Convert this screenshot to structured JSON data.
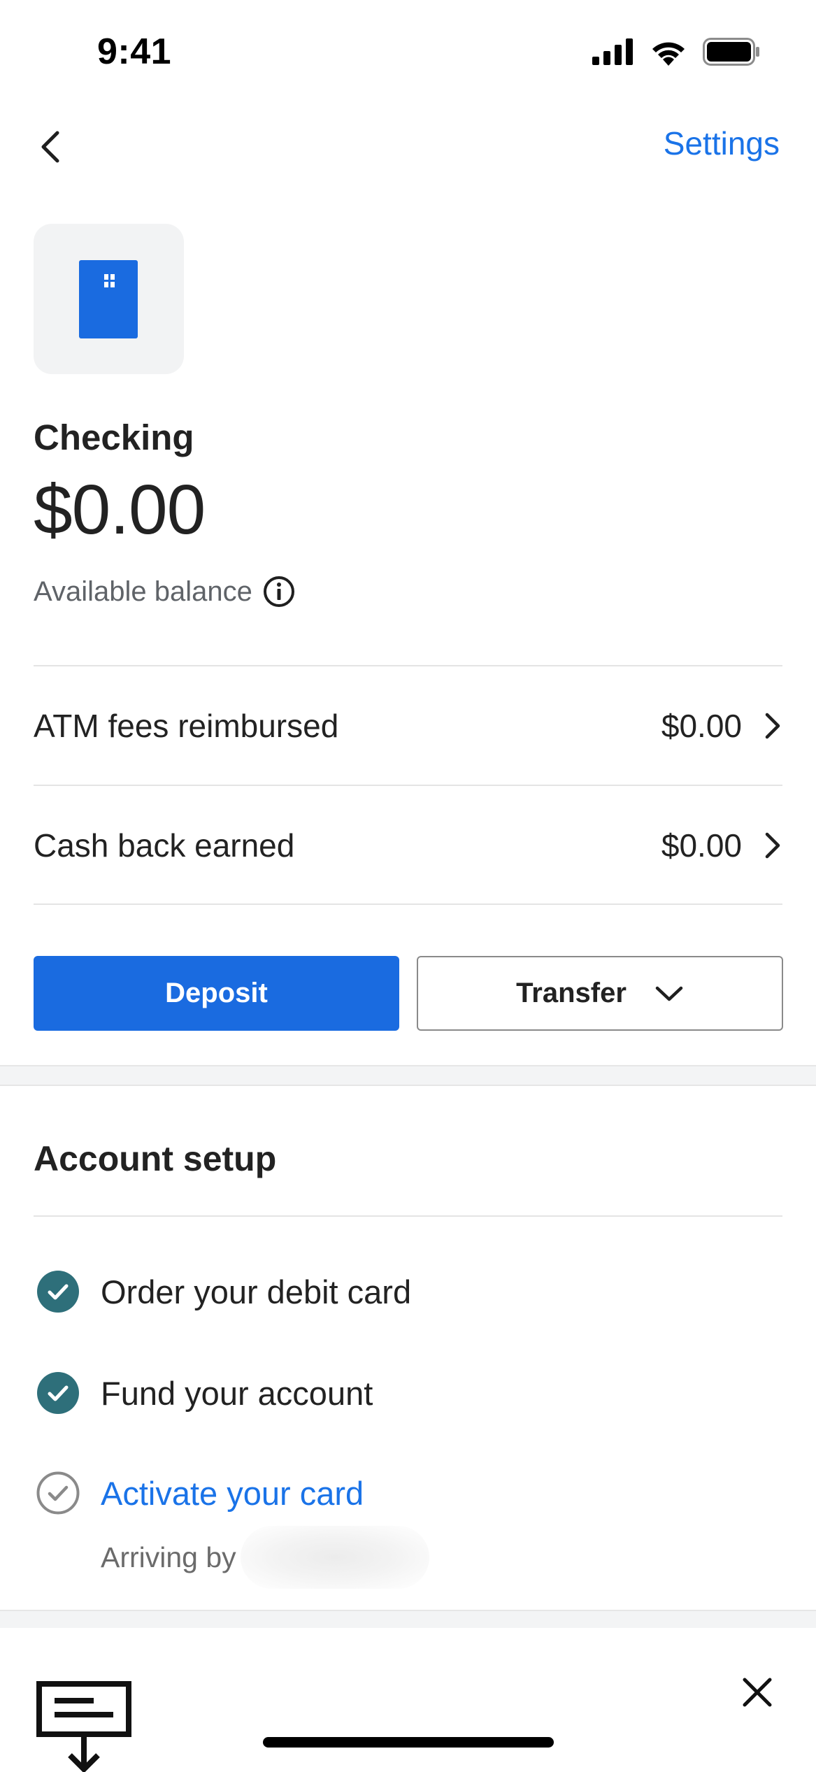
{
  "status_bar": {
    "time": "9:41"
  },
  "nav": {
    "back_icon": "chevron-left-icon",
    "settings_label": "Settings"
  },
  "account": {
    "card_icon": "debit-card-icon",
    "name": "Checking",
    "balance": "$0.00",
    "balance_label": "Available balance",
    "info_icon": "info-icon"
  },
  "summary_rows": [
    {
      "label": "ATM fees reimbursed",
      "value": "$0.00"
    },
    {
      "label": "Cash back earned",
      "value": "$0.00"
    }
  ],
  "actions": {
    "deposit_label": "Deposit",
    "transfer_label": "Transfer"
  },
  "account_setup": {
    "title": "Account setup",
    "tasks": [
      {
        "label": "Order your debit card",
        "completed": true
      },
      {
        "label": "Fund your account",
        "completed": true
      },
      {
        "label": "Activate your card",
        "completed": false,
        "sub_label": "Arriving by"
      }
    ]
  },
  "promo": {
    "icon": "check-deposit-icon",
    "close_icon": "close-icon"
  },
  "colors": {
    "accent": "#1a73e8",
    "primary_button": "#1a6be0",
    "check_complete": "#2e6f7a",
    "check_pending": "#8a8a8a"
  }
}
